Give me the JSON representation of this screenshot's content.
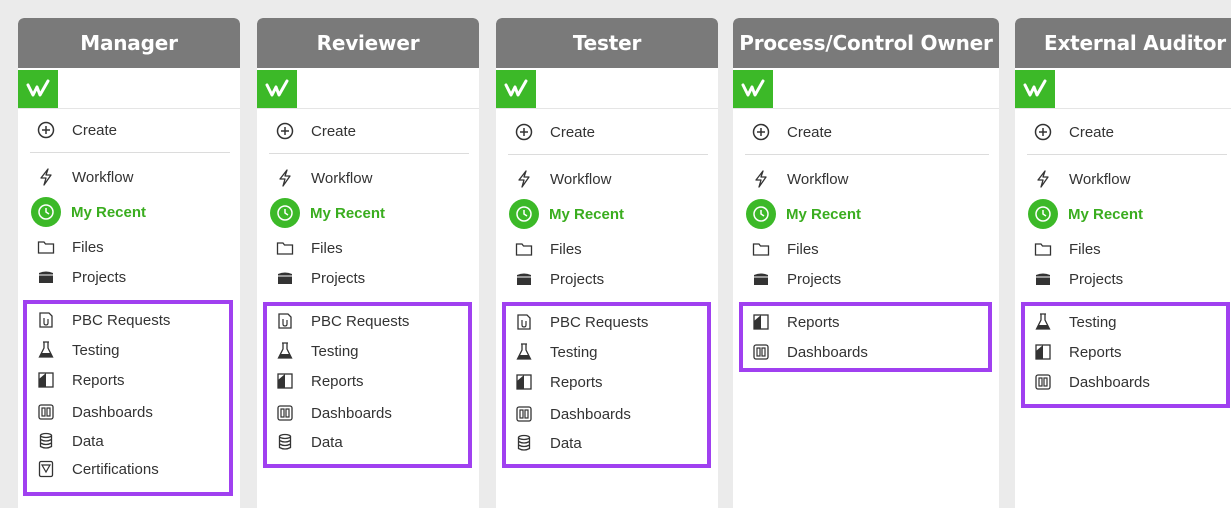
{
  "accent": "#3cb928",
  "highlight_color": "#a040f0",
  "columns": [
    {
      "title": "Manager",
      "create": "Create",
      "workflow": "Workflow",
      "my_recent": "My Recent",
      "files": "Files",
      "projects": "Projects",
      "extra": [
        "PBC Requests",
        "Testing",
        "Reports",
        "Dashboards",
        "Data",
        "Certifications"
      ]
    },
    {
      "title": "Reviewer",
      "create": "Create",
      "workflow": "Workflow",
      "my_recent": "My Recent",
      "files": "Files",
      "projects": "Projects",
      "extra": [
        "PBC Requests",
        "Testing",
        "Reports",
        "Dashboards",
        "Data"
      ]
    },
    {
      "title": "Tester",
      "create": "Create",
      "workflow": "Workflow",
      "my_recent": "My Recent",
      "files": "Files",
      "projects": "Projects",
      "extra": [
        "PBC Requests",
        "Testing",
        "Reports",
        "Dashboards",
        "Data"
      ]
    },
    {
      "title": "Process/Control Owner",
      "create": "Create",
      "workflow": "Workflow",
      "my_recent": "My Recent",
      "files": "Files",
      "projects": "Projects",
      "extra": [
        "Reports",
        "Dashboards"
      ]
    },
    {
      "title": "External Auditor",
      "create": "Create",
      "workflow": "Workflow",
      "my_recent": "My Recent",
      "files": "Files",
      "projects": "Projects",
      "extra": [
        "Testing",
        "Reports",
        "Dashboards"
      ]
    }
  ],
  "icons": {
    "create": "plus-circle-icon",
    "workflow": "lightning-icon",
    "my_recent": "clock-icon",
    "files": "folder-icon",
    "projects": "box-icon",
    "PBC Requests": "clip-document-icon",
    "Testing": "flask-icon",
    "Reports": "report-icon",
    "Dashboards": "dashboard-icon",
    "Data": "database-icon",
    "Certifications": "certificate-icon"
  }
}
